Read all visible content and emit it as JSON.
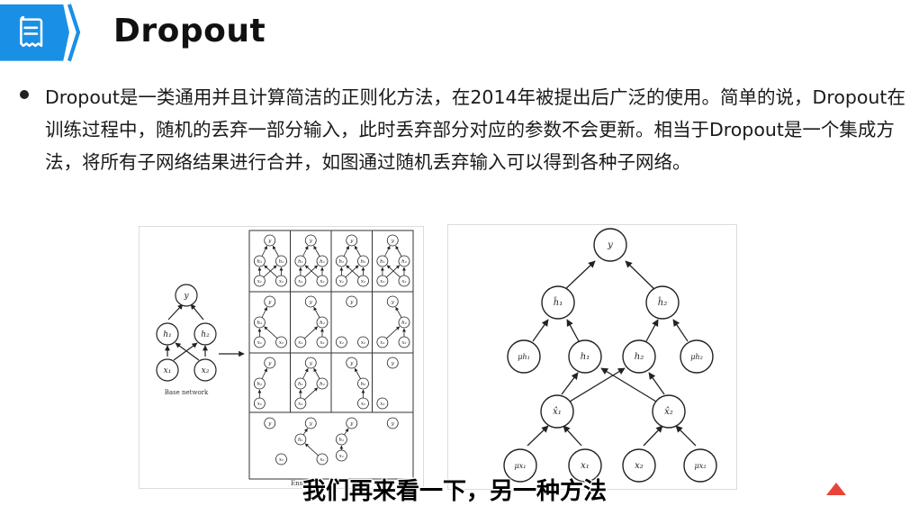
{
  "header": {
    "title": "Dropout",
    "icon": "document-list-icon",
    "accent_color": "#1a8fe6"
  },
  "content": {
    "paragraph": "Dropout是一类通用并且计算简洁的正则化方法，在2014年被提出后广泛的使用。简单的说，Dropout在训练过程中，随机的丢弃一部分输入，此时丢弃部分对应的参数不会更新。相当于Dropout是一个集成方法，将所有子网络结果进行合并，如图通过随机丢弃输入可以得到各种子网络。"
  },
  "figure_left": {
    "base_label": "Base network",
    "ensemble_label": "Ensem",
    "nodes": {
      "y": "y",
      "h1": "h₁",
      "h2": "h₂",
      "x1": "x₁",
      "x2": "x₂"
    }
  },
  "figure_right": {
    "nodes": {
      "y": "y",
      "h1p": "ĥ₁",
      "h2p": "ĥ₂",
      "mu_h1": "μh₁",
      "mu_h2": "μh₂",
      "h1": "h₁",
      "h2": "h₂",
      "x1p": "x̂₁",
      "x2p": "x̂₂",
      "mu_x1": "μx₁",
      "x1": "x₁",
      "x2": "x₂",
      "mu_x2": "μx₂"
    }
  },
  "subtitle": "我们再来看一下，另一种方法"
}
